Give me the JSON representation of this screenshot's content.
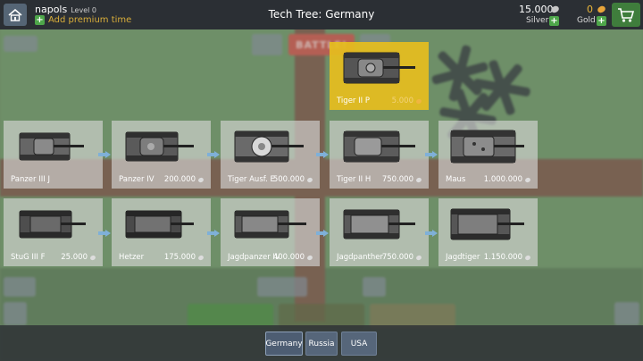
{
  "header": {
    "player_name": "napols",
    "player_level": "Level 0",
    "premium_link": "Add premium time",
    "title": "Tech Tree: Germany",
    "silver_amount": "15.000",
    "silver_label": "Silver",
    "gold_amount": "0",
    "gold_label": "Gold"
  },
  "background": {
    "battle_label": "BATTLE!"
  },
  "tech_tree": {
    "highlight": {
      "name": "Tiger II P",
      "price": "5.000"
    },
    "row1": [
      {
        "name": "Panzer III J",
        "price": ""
      },
      {
        "name": "Panzer IV",
        "price": "200.000"
      },
      {
        "name": "Tiger Ausf. E",
        "price": "500.000"
      },
      {
        "name": "Tiger II H",
        "price": "750.000"
      },
      {
        "name": "Maus",
        "price": "1.000.000"
      }
    ],
    "row2": [
      {
        "name": "StuG III F",
        "price": "25.000"
      },
      {
        "name": "Hetzer",
        "price": "175.000"
      },
      {
        "name": "Jagdpanzer IV",
        "price": "400.000"
      },
      {
        "name": "Jagdpanther",
        "price": "750.000"
      },
      {
        "name": "Jagdtiger",
        "price": "1.150.000"
      }
    ]
  },
  "nations": [
    {
      "label": "Germany"
    },
    {
      "label": "Russia"
    },
    {
      "label": "USA"
    }
  ],
  "colors": {
    "highlight": "#e6be1e",
    "gold": "#e8b53a",
    "plus_green": "#4ea64a",
    "battle_red": "#d46c5e"
  },
  "icons": {
    "home": "home-icon",
    "cart": "cart-icon",
    "coin": "coin-icon",
    "arrow": "arrow-right-icon"
  }
}
